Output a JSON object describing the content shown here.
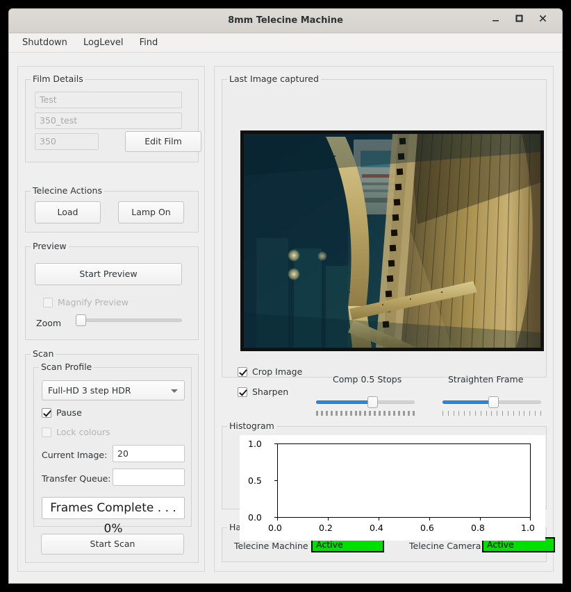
{
  "window": {
    "title": "8mm Telecine Machine",
    "buttons": {
      "minimize": "minimize-icon",
      "maximize": "maximize-icon",
      "close": "close-icon"
    }
  },
  "menubar": {
    "items": [
      {
        "label": "Shutdown"
      },
      {
        "label": "LogLevel"
      },
      {
        "label": "Find"
      }
    ]
  },
  "film_details": {
    "title": "Film Details",
    "name_field": {
      "value": "Test",
      "enabled": false
    },
    "folder_field": {
      "value": "350_test",
      "enabled": false
    },
    "count_field": {
      "value": "350",
      "enabled": false
    },
    "edit_button": "Edit Film"
  },
  "telecine_actions": {
    "title": "Telecine Actions",
    "load_button": "Load",
    "lamp_button": "Lamp On"
  },
  "preview": {
    "title": "Preview",
    "start_button": "Start Preview",
    "magnify_checkbox": {
      "label": "Magnify Preview",
      "checked": false,
      "enabled": false
    },
    "zoom_label": "Zoom",
    "zoom_slider": {
      "value": 0,
      "min": 0,
      "max": 100,
      "enabled": false
    }
  },
  "scan": {
    "title": "Scan",
    "profile_title": "Scan Profile",
    "profile_value": "Full-HD 3 step HDR",
    "pause_checkbox": {
      "label": "Pause",
      "checked": true,
      "enabled": true
    },
    "lock_colours_checkbox": {
      "label": "Lock colours",
      "checked": false,
      "enabled": false
    },
    "current_image_label": "Current Image:",
    "current_image_value": "20",
    "transfer_queue_label": "Transfer Queue:",
    "transfer_queue_value": "",
    "frames_complete": "Frames Complete . . . 0%",
    "start_scan_button": "Start Scan"
  },
  "last_image": {
    "title": "Last Image captured",
    "photo_alt": "film-reel-photo"
  },
  "image_controls": {
    "crop_checkbox": {
      "label": "Crop Image",
      "checked": true
    },
    "sharpen_checkbox": {
      "label": "Sharpen",
      "checked": true
    },
    "comp_label": "Comp 0.5 Stops",
    "comp_slider": {
      "value": 57,
      "min": 0,
      "max": 100,
      "tick_count": 21
    },
    "straighten_label": "Straighten Frame",
    "straighten_slider": {
      "value": 51,
      "min": 0,
      "max": 100,
      "tick_count": 19
    }
  },
  "histogram": {
    "title": "Histogram"
  },
  "chart_data": {
    "type": "line",
    "title": "",
    "xlabel": "",
    "ylabel": "",
    "xlim": [
      0.0,
      1.0
    ],
    "ylim": [
      0.0,
      1.0
    ],
    "xticks": [
      "0.0",
      "0.2",
      "0.4",
      "0.6",
      "0.8",
      "1.0"
    ],
    "yticks": [
      "0.0",
      "0.5",
      "1.0"
    ],
    "grid": false,
    "legend": null,
    "series": []
  },
  "hardware": {
    "title": "Hardware",
    "machine_label": "Telecine Machine",
    "machine_status": "Active",
    "camera_label": "Telecine Camera",
    "camera_status": "Active",
    "status_color": "#00e000"
  }
}
